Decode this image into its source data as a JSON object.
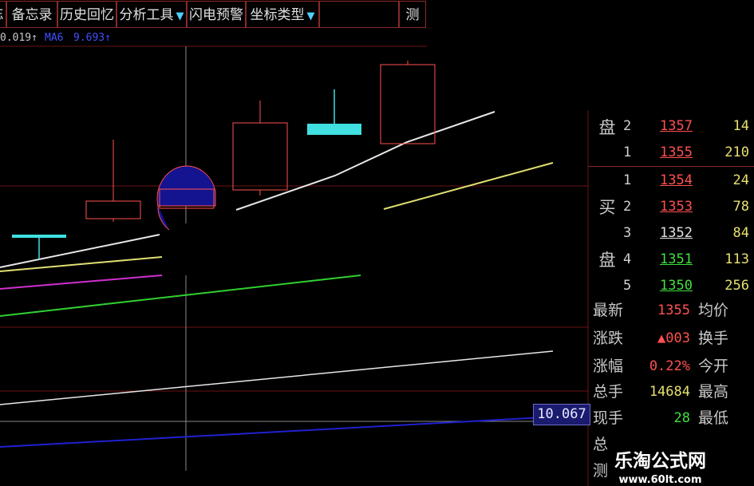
{
  "toolbar": {
    "items": [
      {
        "label": "忘"
      },
      {
        "label": "备忘录"
      },
      {
        "label": "历史回忆"
      },
      {
        "label": "分析工具"
      },
      {
        "label": "闪电预警"
      },
      {
        "label": "坐标类型"
      },
      {
        "label": "测"
      }
    ]
  },
  "indicators": {
    "ma_a": "0.019↑",
    "ma_b_name": "MA6",
    "ma_b_value": "9.693↑"
  },
  "orderbook": {
    "sell_label_1": "盘",
    "sell": [
      {
        "level": "2",
        "price": "1357",
        "vol": "14"
      },
      {
        "level": "1",
        "price": "1355",
        "vol": "210"
      }
    ],
    "buy_label_1": "买",
    "buy_label_2": "盘",
    "buy": [
      {
        "level": "1",
        "price": "1354",
        "vol": "24"
      },
      {
        "level": "2",
        "price": "1353",
        "vol": "78"
      },
      {
        "level": "3",
        "price": "1352",
        "vol": "84"
      },
      {
        "level": "4",
        "price": "1351",
        "vol": "113"
      },
      {
        "level": "5",
        "price": "1350",
        "vol": "256"
      }
    ]
  },
  "stats": [
    {
      "label": "最新",
      "value": "1355",
      "label2": "均价"
    },
    {
      "label": "涨跌",
      "value": "▲003",
      "label2": "换手"
    },
    {
      "label": "涨幅",
      "value": "0.22%",
      "label2": "今开"
    },
    {
      "label": "总手",
      "value": "14684",
      "label2": "最高"
    },
    {
      "label": "现手",
      "value": "28",
      "label2": "最低"
    },
    {
      "label": "总",
      "value": "",
      "label2": ""
    },
    {
      "label": "测",
      "value": "",
      "label2": ""
    }
  ],
  "price_tag": "10.067",
  "watermark": {
    "title": "乐淘公式网",
    "url": "www.60lt.com"
  },
  "colors": {
    "up": "#ff5050",
    "down": "#40e0e0",
    "grid": "#7a1a1a",
    "accent": "#4fd0ff"
  }
}
